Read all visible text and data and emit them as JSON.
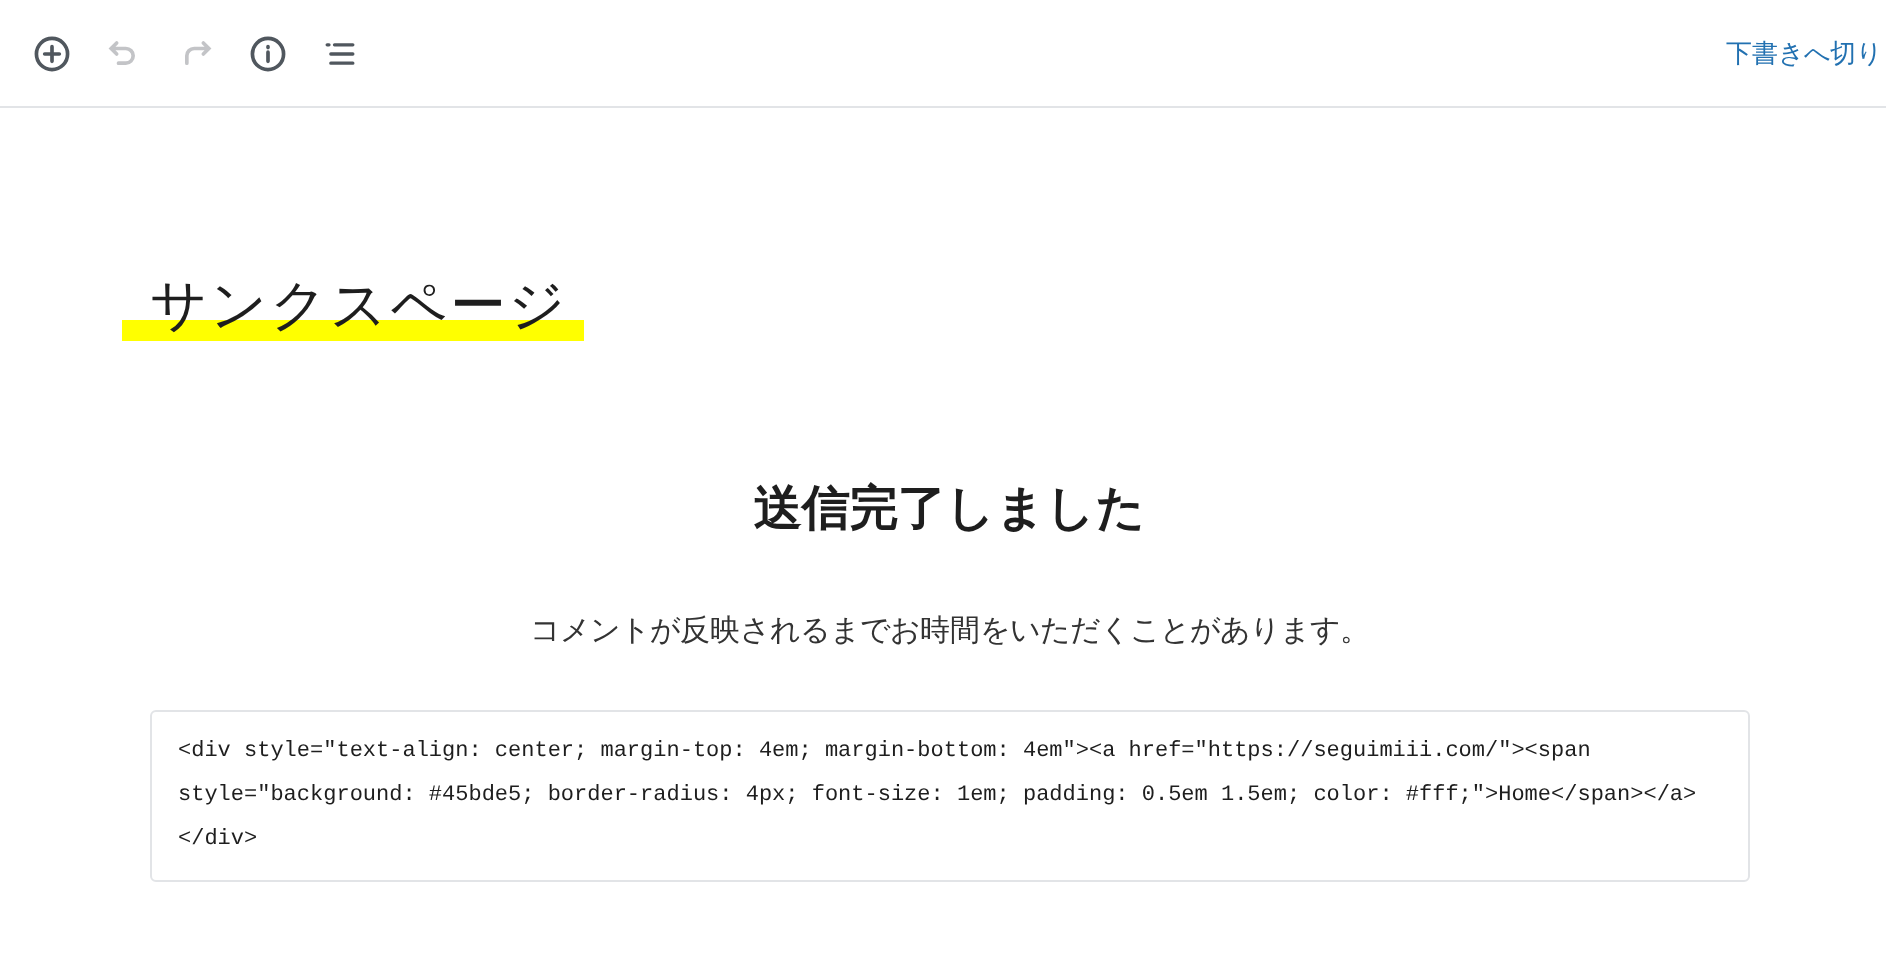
{
  "toolbar": {
    "buttons": [
      {
        "kind": "add",
        "disabled": false
      },
      {
        "kind": "undo",
        "disabled": true
      },
      {
        "kind": "redo",
        "disabled": true
      },
      {
        "kind": "info",
        "disabled": false
      },
      {
        "kind": "outline",
        "disabled": false
      }
    ],
    "draft_link": "下書きへ切り"
  },
  "page_title": "サンクスページ",
  "heading": "送信完了しました",
  "paragraph": "コメントが反映されるまでお時間をいただくことがあります。",
  "code": "<div style=\"text-align: center; margin-top: 4em; margin-bottom: 4em\"><a href=\"https://seguimiii.com/\"><span style=\"background: #45bde5; border-radius: 4px; font-size: 1em; padding: 0.5em 1.5em; color: #fff;\">Home</span></a></div>"
}
